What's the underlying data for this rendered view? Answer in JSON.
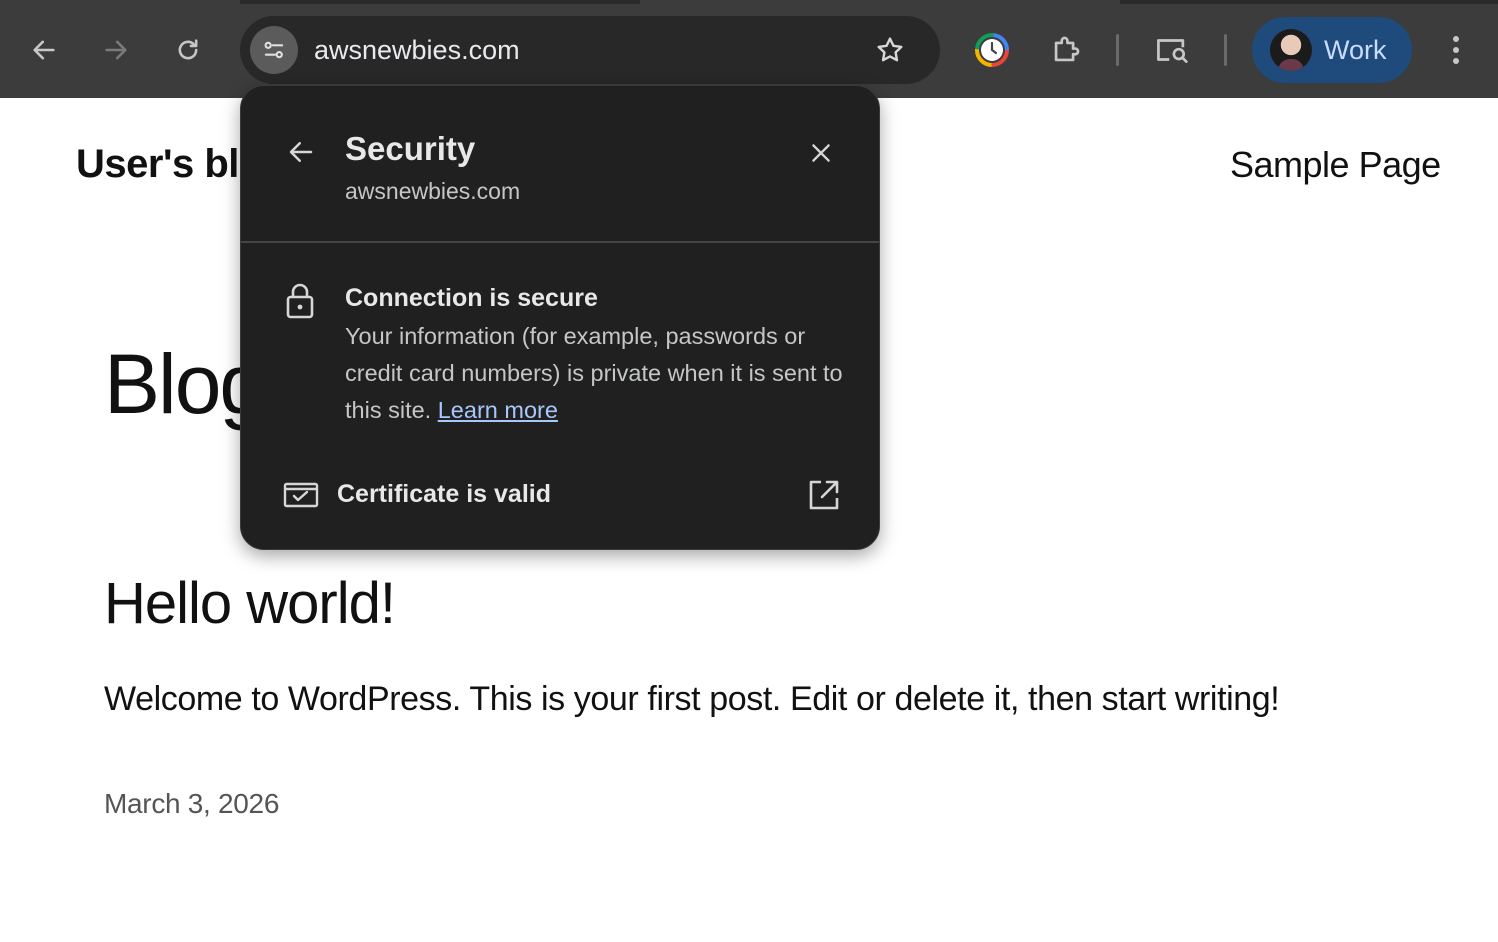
{
  "browser": {
    "url": "awsnewbies.com",
    "profile_label": "Work",
    "accent_color": "#1f4a7c"
  },
  "toolbar_icons": [
    "back-icon",
    "forward-icon",
    "reload-icon",
    "site-info-icon",
    "bookmark-star-icon",
    "history-clock-icon",
    "extensions-puzzle-icon",
    "search-tab-icon",
    "more-vert-icon"
  ],
  "page": {
    "site_title": "User's blc",
    "nav_link": "Sample Page",
    "heading": "Blog",
    "post_title": "Hello world!",
    "post_excerpt": "Welcome to WordPress. This is your first post. Edit or delete it, then start writing!",
    "post_date": "March 3, 2026"
  },
  "security_popup": {
    "title": "Security",
    "subtitle": "awsnewbies.com",
    "connection_heading": "Connection is secure",
    "connection_body": "Your information (for example, passwords or credit card numbers) is private when it is sent to this site.",
    "learn_more": "Learn more",
    "certificate_label": "Certificate is valid",
    "link_color": "#a8c7fa"
  }
}
